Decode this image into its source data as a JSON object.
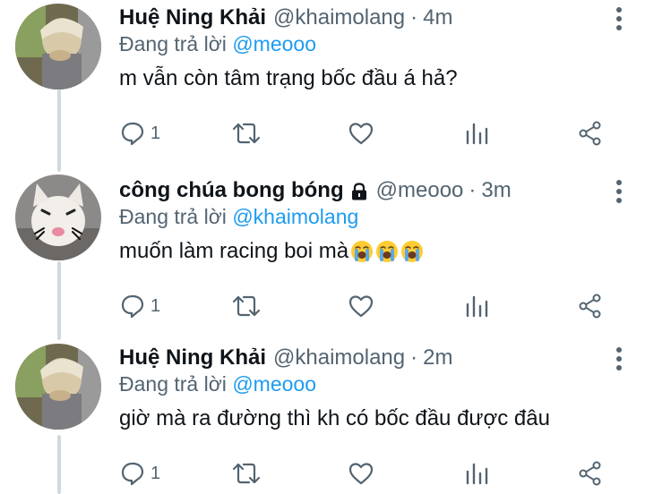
{
  "tweets": [
    {
      "author_name": "Huệ Ning Khải",
      "handle": "@khaimolang",
      "separator": "·",
      "time": "4m",
      "replying_prefix": "Đang trả lời",
      "replying_to": "@meooo",
      "text": "m vẫn còn tâm trạng bốc đầu á hả?",
      "reply_count": "1",
      "avatar": "person-avatar"
    },
    {
      "author_name": "công chúa bong bóng",
      "protected_icon": "lock-icon",
      "handle": "@meooo",
      "separator": "·",
      "time": "3m",
      "replying_prefix": "Đang trả lời",
      "replying_to": "@khaimolang",
      "text": "muốn làm racing boi mà",
      "emojis": [
        "loudly-crying-face",
        "loudly-crying-face",
        "loudly-crying-face"
      ],
      "reply_count": "1",
      "avatar": "cat-avatar"
    },
    {
      "author_name": "Huệ Ning Khải",
      "handle": "@khaimolang",
      "separator": "·",
      "time": "2m",
      "replying_prefix": "Đang trả lời",
      "replying_to": "@meooo",
      "text": "giờ mà ra đường thì kh có bốc đầu được đâu",
      "reply_count": "1",
      "avatar": "person-avatar"
    }
  ],
  "colors": {
    "text": "#0f1419",
    "secondary": "#536471",
    "link": "#1d9bf0",
    "thread_line": "#cfd9de",
    "emoji_yellow": "#ffcc33",
    "emoji_tears": "#5aa9e6"
  }
}
